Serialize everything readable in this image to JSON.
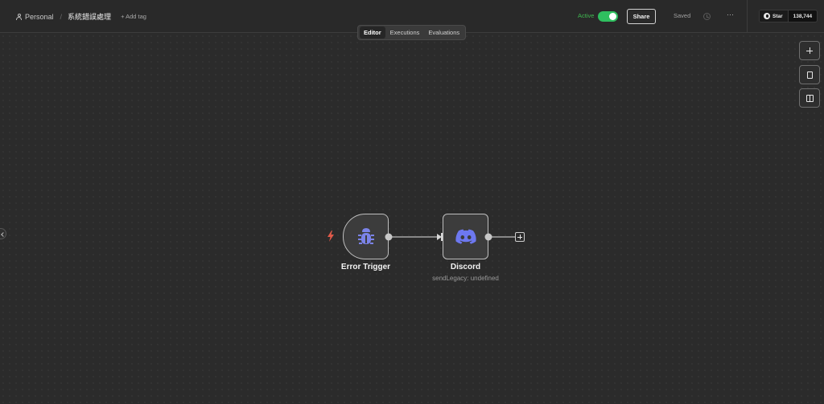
{
  "header": {
    "project": "Personal",
    "workflow_title": "系統錯誤處理",
    "add_tag": "+ Add tag",
    "active_label": "Active",
    "active": true,
    "share_label": "Share",
    "saved_label": "Saved",
    "more_label": "···",
    "github_star_label": "Star",
    "github_star_count": "138,744"
  },
  "tabs": [
    {
      "label": "Editor",
      "active": true
    },
    {
      "label": "Executions",
      "active": false
    },
    {
      "label": "Evaluations",
      "active": false
    }
  ],
  "canvas": {
    "side_buttons": [
      {
        "icon": "plus-icon"
      },
      {
        "icon": "sticky-note-icon"
      },
      {
        "icon": "panel-toggle-icon"
      }
    ],
    "nodes": [
      {
        "name": "Error Trigger",
        "icon": "bug-icon",
        "subtitle": ""
      },
      {
        "name": "Discord",
        "icon": "discord-icon",
        "subtitle": "sendLegacy: undefined"
      }
    ]
  },
  "colors": {
    "accent_green": "#2fbf5f",
    "node_icon": "#7b83e8",
    "trigger_bolt": "#e05a4a",
    "background": "#2b2b2b"
  }
}
